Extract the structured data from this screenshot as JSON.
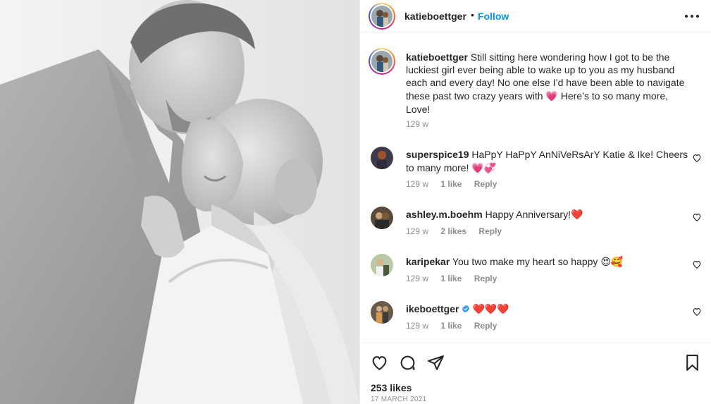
{
  "post": {
    "username": "katieboettger",
    "follow_label": "Follow",
    "dot": "•",
    "caption_username": "katieboettger",
    "caption_text_1": "Still sitting here wondering how I got to be the luckiest girl ever being able to wake up to you as my husband each and every day! No one else I’d have been able to navigate these past two crazy years with ",
    "caption_emoji": "💗",
    "caption_text_2": " Here’s to so many more, Love!",
    "caption_time": "129 w",
    "likes": "253 likes",
    "date": "17 MARCH 2021"
  },
  "comments": [
    {
      "username": "superspice19",
      "text": "HaPpY HaPpY AnNiVeRsArY Katie & Ike! Cheers to many more!",
      "emoji": "💗💞",
      "time": "129 w",
      "likes": "1 like",
      "reply": "Reply"
    },
    {
      "username": "ashley.m.boehm",
      "text": "Happy Anniversary!",
      "emoji": "❤️",
      "time": "129 w",
      "likes": "2 likes",
      "reply": "Reply"
    },
    {
      "username": "karipekar",
      "text": "You two make my heart so happy",
      "emoji": "😍🥰",
      "time": "129 w",
      "likes": "1 like",
      "reply": "Reply"
    },
    {
      "username": "ikeboettger",
      "text": "",
      "emoji": "❤️❤️❤️",
      "time": "129 w",
      "likes": "1 like",
      "reply": "Reply"
    }
  ],
  "icons": {
    "more": "more-options-icon",
    "like": "heart-icon",
    "comment": "comment-icon",
    "share": "share-icon",
    "save": "bookmark-icon",
    "verified": "verified-badge-icon"
  },
  "colors": {
    "link": "#0095f6",
    "secondary_text": "#8e8e8e",
    "primary_text": "#262626",
    "verified": "#3897f0"
  }
}
